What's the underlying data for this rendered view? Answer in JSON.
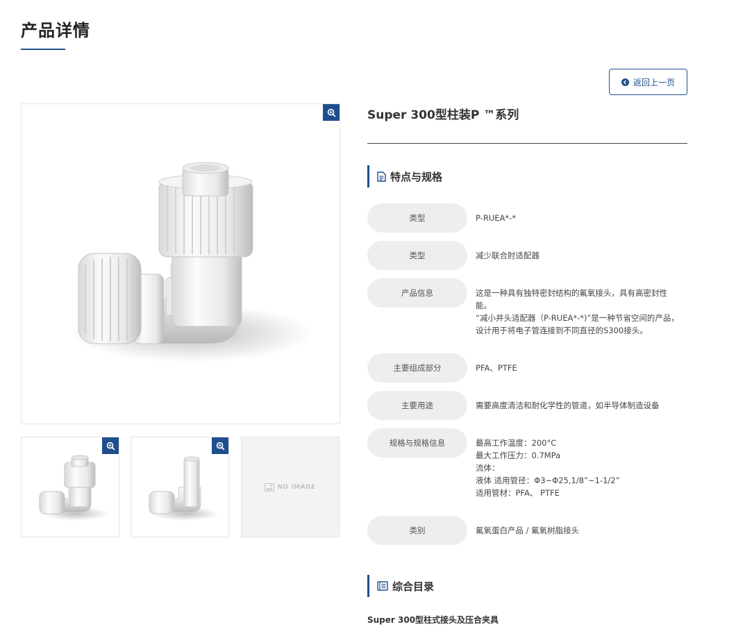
{
  "page": {
    "title": "产品详情",
    "back_label": "返回上一页"
  },
  "gallery": {
    "no_image_label": "NO IMAGE",
    "zoom_icon": "zoom-in-icon"
  },
  "product": {
    "title": "Super 300型柱装P ™系列"
  },
  "specs_section": {
    "title": "特点与规格",
    "rows": [
      {
        "label": "类型",
        "lines": [
          "P-RUEA*-*"
        ]
      },
      {
        "label": "类型",
        "lines": [
          "减少联合肘适配器"
        ]
      },
      {
        "label": "产品信息",
        "lines": [
          "这是一种具有独特密封结构的氟氧接头，具有高密封性",
          "能。",
          "“减小并头适配器（P-RUEA*-*)”是一种节省空间的产品，",
          "设计用于将电子管连接到不同直径的S300接头。"
        ]
      },
      {
        "label": "主要组成部分",
        "lines": [
          "PFA、PTFE"
        ]
      },
      {
        "label": "主要用途",
        "lines": [
          "需要高度清洁和耐化学性的管道，如半导体制造设备"
        ]
      },
      {
        "label": "规格与规格信息",
        "lines": [
          "最高工作温度：200°C",
          "最大工作压力：0.7MPa",
          "流体：",
          "液体 适用管径：Φ3~Φ25,1/8”~1-1/2”",
          "适用管材：PFA、 PTFE"
        ]
      },
      {
        "label": "类别",
        "lines": [
          "氟氧蛋白产品 / 氟氧树脂接头"
        ]
      }
    ]
  },
  "catalog_section": {
    "title": "综合目录",
    "link_label": "Super 300型柱式接头及压合夹具"
  },
  "colors": {
    "accent": "#1f4e8c",
    "label_bg": "#eceef0"
  }
}
